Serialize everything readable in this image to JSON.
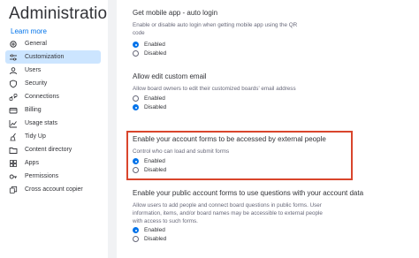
{
  "sidebar": {
    "title": "Administration",
    "learn_more": "Learn more",
    "items": [
      {
        "label": "General",
        "icon": "gear-icon",
        "active": false
      },
      {
        "label": "Customization",
        "icon": "sliders-icon",
        "active": true
      },
      {
        "label": "Users",
        "icon": "users-icon",
        "active": false
      },
      {
        "label": "Security",
        "icon": "shield-icon",
        "active": false
      },
      {
        "label": "Connections",
        "icon": "connections-icon",
        "active": false
      },
      {
        "label": "Billing",
        "icon": "card-icon",
        "active": false
      },
      {
        "label": "Usage stats",
        "icon": "chart-icon",
        "active": false
      },
      {
        "label": "Tidy Up",
        "icon": "broom-icon",
        "active": false
      },
      {
        "label": "Content directory",
        "icon": "folder-icon",
        "active": false
      },
      {
        "label": "Apps",
        "icon": "apps-icon",
        "active": false
      },
      {
        "label": "Permissions",
        "icon": "key-icon",
        "active": false
      },
      {
        "label": "Cross account copier",
        "icon": "copy-icon",
        "active": false
      }
    ]
  },
  "sections": [
    {
      "title": "Get mobile app - auto login",
      "description": "Enable or disable auto login when getting mobile app using the QR code",
      "options": [
        {
          "label": "Enabled",
          "checked": true
        },
        {
          "label": "Disabled",
          "checked": false
        }
      ]
    },
    {
      "title": "Allow edit custom email",
      "description": "Allow board owners to edit their customized boards' email address",
      "options": [
        {
          "label": "Enabled",
          "checked": false
        },
        {
          "label": "Disabled",
          "checked": true
        }
      ]
    },
    {
      "title": "Enable your account forms to be accessed by external people",
      "description": "Control who can load and submit forms",
      "options": [
        {
          "label": "Enabled",
          "checked": true
        },
        {
          "label": "Disabled",
          "checked": false
        }
      ]
    },
    {
      "title": "Enable your public account forms to use questions with your account data",
      "description": "Allow users to add people and connect board questions in public forms. User information, items, and/or board names may be accessible to external people with access to such forms.",
      "options": [
        {
          "label": "Enabled",
          "checked": true
        },
        {
          "label": "Disabled",
          "checked": false
        }
      ]
    }
  ],
  "colors": {
    "accent": "#0073ea",
    "active_nav": "#cce5ff",
    "highlight_border": "#d9452c"
  }
}
